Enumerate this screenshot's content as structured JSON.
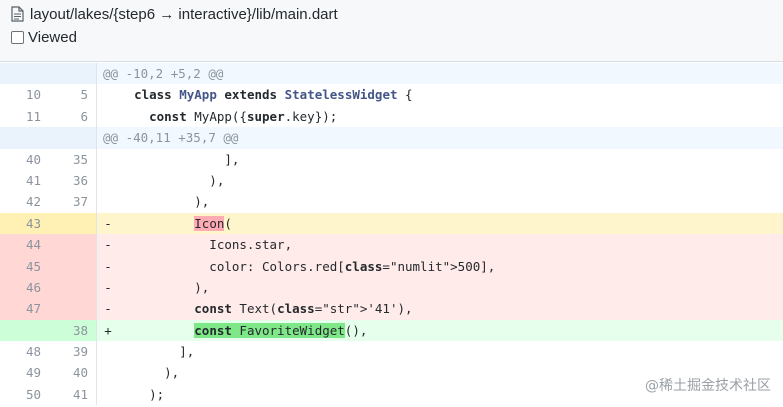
{
  "file": {
    "path": "layout/lakes/{step6 → interactive}/lib/main.dart",
    "viewed_label": "Viewed"
  },
  "diff": {
    "hunks": [
      "@@ -10,2 +5,2 @@",
      "@@ -40,11 +35,7 @@"
    ],
    "lines": [
      {
        "old": "10",
        "new": "5",
        "sign": "",
        "code": "  class MyApp extends StatelessWidget {"
      },
      {
        "old": "11",
        "new": "6",
        "sign": "",
        "code": "    const MyApp({super.key});"
      },
      {
        "old": "40",
        "new": "35",
        "sign": "",
        "code": "              ],"
      },
      {
        "old": "41",
        "new": "36",
        "sign": "",
        "code": "            ),"
      },
      {
        "old": "42",
        "new": "37",
        "sign": "",
        "code": "          ),"
      },
      {
        "old": "43",
        "new": "",
        "sign": "-",
        "code": "          Icon("
      },
      {
        "old": "44",
        "new": "",
        "sign": "-",
        "code": "            Icons.star,"
      },
      {
        "old": "45",
        "new": "",
        "sign": "-",
        "code": "            color: Colors.red[500],"
      },
      {
        "old": "46",
        "new": "",
        "sign": "-",
        "code": "          ),"
      },
      {
        "old": "47",
        "new": "",
        "sign": "-",
        "code": "          const Text('41'),"
      },
      {
        "old": "",
        "new": "38",
        "sign": "+",
        "code": "          const FavoriteWidget(),"
      },
      {
        "old": "48",
        "new": "39",
        "sign": "",
        "code": "        ],"
      },
      {
        "old": "49",
        "new": "40",
        "sign": "",
        "code": "      ),"
      },
      {
        "old": "50",
        "new": "41",
        "sign": "",
        "code": "    );"
      }
    ]
  },
  "watermark": "@稀土掘金技术社区",
  "colors": {
    "deleted_bg": "#ffebe9",
    "added_bg": "#e6ffec",
    "active_line_bg": "#fff5cc",
    "hunk_bg": "#f1f8ff"
  }
}
